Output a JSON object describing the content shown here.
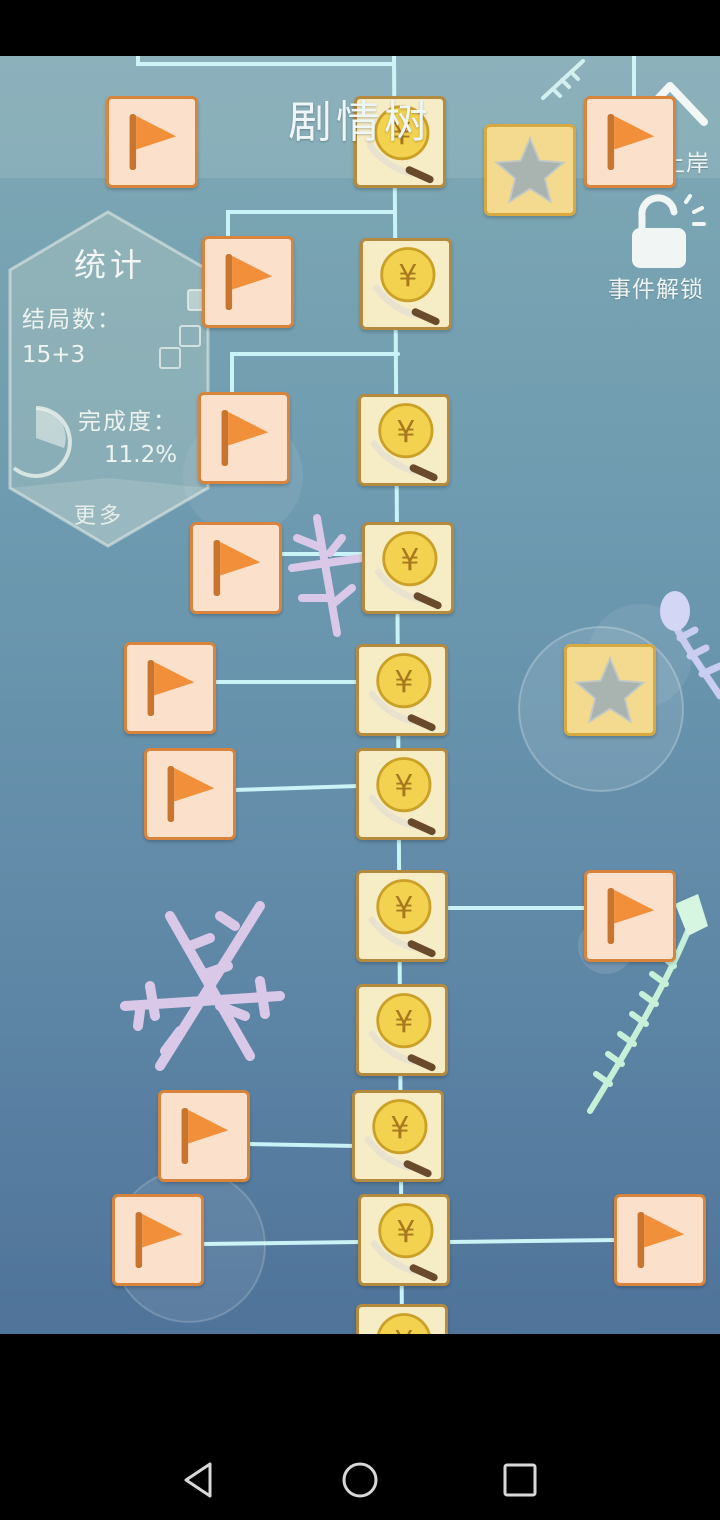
{
  "header": {
    "title": "剧情树"
  },
  "side": {
    "back_label": "上岸",
    "unlock_label": "事件解锁",
    "icons": [
      "chevron-up-icon",
      "open-lock-icon"
    ]
  },
  "stats": {
    "title": "统计",
    "endings_label": "结局数：",
    "endings_value": "15+3",
    "completion_label": "完成度：",
    "completion_value": "11.2%",
    "more_label": "更多"
  },
  "tiles": {
    "legend": {
      "flag": "orange-flag-icon",
      "coin": "yen-coin-knife-icon",
      "star": "star-icon"
    }
  },
  "colors": {
    "background_top": "#80a9b4",
    "background_bottom": "#4f7399",
    "flag_fill": "#f28f3b",
    "coin_fill": "#f2d24e",
    "branch_line": "#c9f3f6"
  }
}
